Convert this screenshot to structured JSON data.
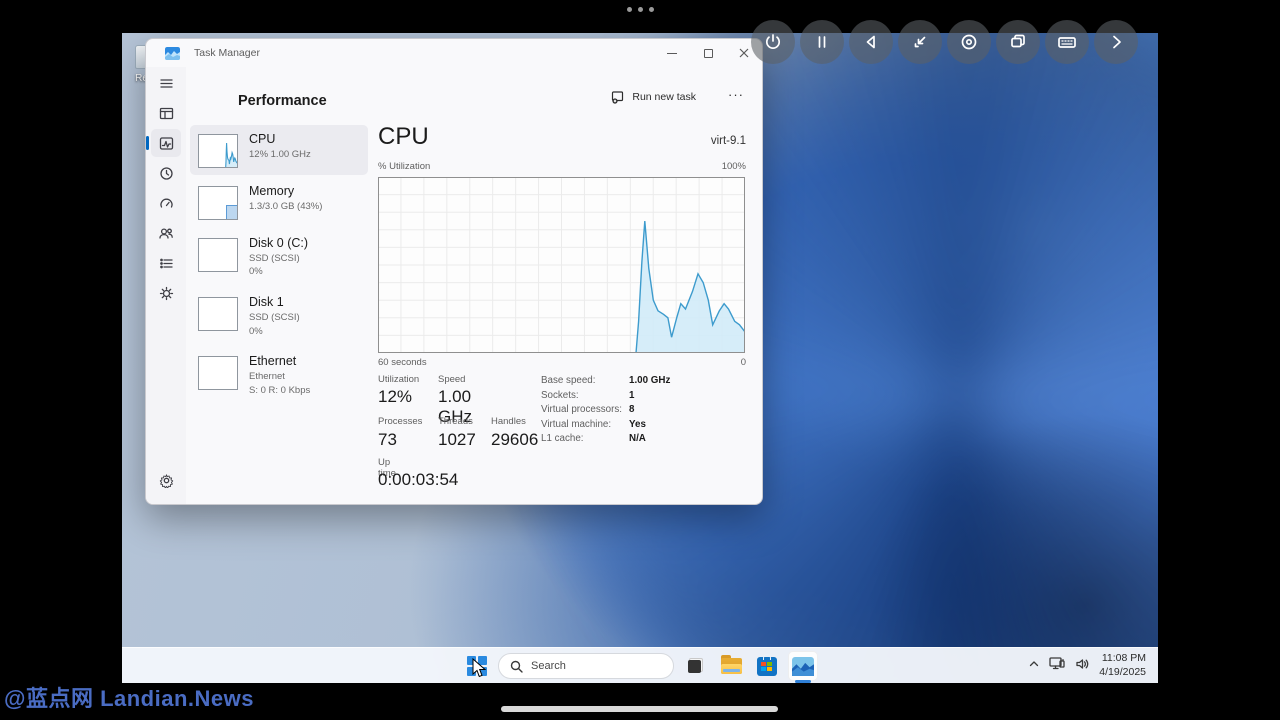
{
  "vm_toolbar": {
    "buttons": [
      "power",
      "pause",
      "back",
      "shrink",
      "disc",
      "windows",
      "keyboard",
      "forward"
    ]
  },
  "window": {
    "title": "Task Manager"
  },
  "header": {
    "title": "Performance",
    "run_new_task": "Run new task",
    "more": "···"
  },
  "nav": {
    "items": [
      "menu",
      "processes",
      "performance",
      "app-history",
      "startup-apps",
      "users",
      "details",
      "services"
    ],
    "selected": "performance",
    "settings": "settings"
  },
  "device_list": {
    "items": [
      {
        "name": "CPU",
        "line2": "12% 1.00 GHz",
        "line3": ""
      },
      {
        "name": "Memory",
        "line2": "1.3/3.0 GB (43%)",
        "line3": ""
      },
      {
        "name": "Disk 0 (C:)",
        "line2": "SSD (SCSI)",
        "line3": "0%"
      },
      {
        "name": "Disk 1",
        "line2": "SSD (SCSI)",
        "line3": "0%"
      },
      {
        "name": "Ethernet",
        "line2": "Ethernet",
        "line3": "S: 0 R: 0 Kbps"
      }
    ],
    "memory_thumb": {
      "width_frac": 0.3,
      "height_frac": 0.43
    }
  },
  "cpu_panel": {
    "title": "CPU",
    "device": "virt-9.1",
    "util_label": "% Utilization",
    "util_max": "100%",
    "time_left": "60 seconds",
    "time_right": "0",
    "stats_left": [
      {
        "label": "Utilization",
        "value": "12%"
      },
      {
        "label": "Speed",
        "value": "1.00 GHz"
      },
      {
        "label": "Processes",
        "value": "73"
      },
      {
        "label": "Threads",
        "value": "1027"
      },
      {
        "label": "Handles",
        "value": "29606"
      }
    ],
    "stats_right": [
      {
        "label": "Base speed:",
        "value": "1.00 GHz"
      },
      {
        "label": "Sockets:",
        "value": "1"
      },
      {
        "label": "Virtual processors:",
        "value": "8"
      },
      {
        "label": "Virtual machine:",
        "value": "Yes"
      },
      {
        "label": "L1 cache:",
        "value": "N/A"
      }
    ],
    "uptime_label": "Up time",
    "uptime_value": "0:00:03:54"
  },
  "chart_data": {
    "type": "area",
    "title": "CPU % Utilization, last 60 seconds",
    "ylabel": "% Utilization",
    "ylim": [
      0,
      100
    ],
    "x_axis": {
      "left_label": "60 seconds",
      "right_label": "0"
    },
    "grid": {
      "cols": 16,
      "rows": 10,
      "on": true
    },
    "line_color": "#3d9bcd",
    "fill_color": "#d2ebf8",
    "border_color": "#8f8f8f",
    "grid_color": "#ebebeb",
    "points": [
      [
        0.703,
        0
      ],
      [
        0.71,
        18
      ],
      [
        0.719,
        52
      ],
      [
        0.727,
        75
      ],
      [
        0.738,
        48
      ],
      [
        0.75,
        30
      ],
      [
        0.763,
        24
      ],
      [
        0.778,
        22
      ],
      [
        0.79,
        20
      ],
      [
        0.8,
        9
      ],
      [
        0.814,
        20
      ],
      [
        0.825,
        28
      ],
      [
        0.838,
        25
      ],
      [
        0.857,
        35
      ],
      [
        0.872,
        45
      ],
      [
        0.886,
        40
      ],
      [
        0.9,
        30
      ],
      [
        0.912,
        16
      ],
      [
        0.93,
        24
      ],
      [
        0.943,
        28
      ],
      [
        0.955,
        25
      ],
      [
        0.972,
        18
      ],
      [
        0.985,
        16
      ],
      [
        1.0,
        12
      ]
    ]
  },
  "taskbar": {
    "search_placeholder": "Search",
    "apps": [
      "start",
      "search",
      "task-view",
      "file-explorer",
      "microsoft-store",
      "task-manager"
    ],
    "active_app": "task-manager",
    "tray": {
      "time": "11:08 PM",
      "date": "4/19/2025"
    }
  },
  "desktop": {
    "recycle_bin_label": "Rec",
    "accent_color": "#0067c0"
  },
  "overlay": {
    "watermark": "@蓝点网 Landian.News"
  }
}
